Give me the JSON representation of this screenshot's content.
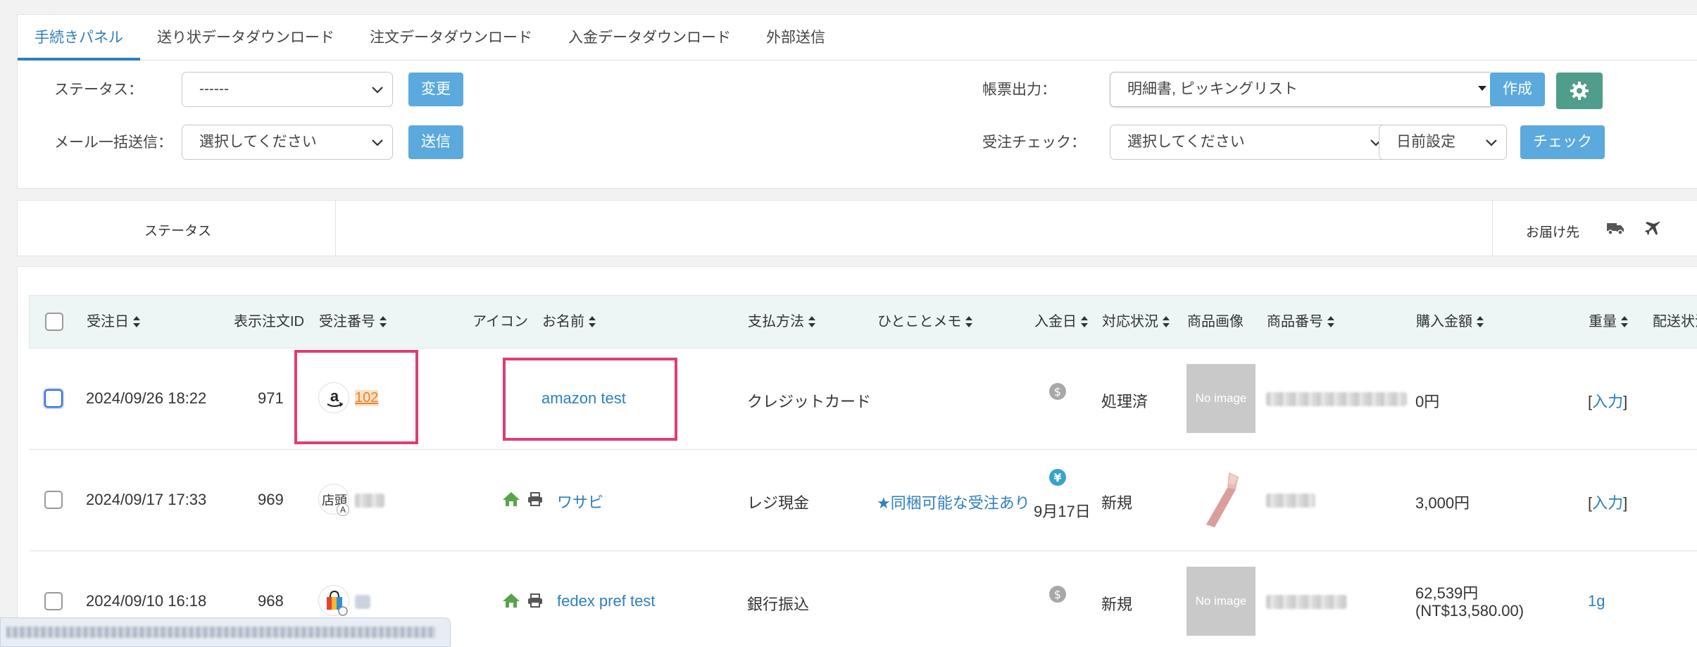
{
  "tabs": [
    {
      "label": "手続きパネル",
      "active": true
    },
    {
      "label": "送り状データダウンロード"
    },
    {
      "label": "注文データダウンロード"
    },
    {
      "label": "入金データダウンロード"
    },
    {
      "label": "外部送信"
    }
  ],
  "filters": {
    "status_label": "ステータス：",
    "status_value": "------",
    "change_button": "変更",
    "mail_label": "メール一括送信：",
    "mail_value": "選択してください",
    "send_button": "送信",
    "form_output_label": "帳票出力：",
    "form_output_value": "明細書, ピッキングリスト",
    "create_button": "作成",
    "order_check_label": "受注チェック：",
    "order_check_value": "選択してください",
    "date_setting_value": "日前設定",
    "check_button": "チェック"
  },
  "summary": {
    "status_label": "ステータス",
    "delivery_label": "お届け先"
  },
  "columns": {
    "order_date": "受注日",
    "display_id": "表示注文ID",
    "order_number": "受注番号",
    "icon": "アイコン",
    "name": "お名前",
    "payment": "支払方法",
    "memo": "ひとことメモ",
    "payment_date": "入金日",
    "handling_status": "対応状況",
    "product_image": "商品画像",
    "product_number": "商品番号",
    "purchase_amount": "購入金額",
    "weight": "重量",
    "shipping_status": "配送状況"
  },
  "rows": [
    {
      "date": "2024/09/26 18:22",
      "display_id": "971",
      "order_number": "102",
      "name": "amazon test",
      "payment": "クレジットカード",
      "memo": "",
      "payment_date": "",
      "status": "処理済",
      "image_text": "No image",
      "amount": "0円",
      "weight_prefix": "[",
      "weight_link": "入力",
      "weight_suffix": "]"
    },
    {
      "date": "2024/09/17 17:33",
      "display_id": "969",
      "shop_label": "店頭",
      "shop_sub": "A",
      "name": "ワサビ",
      "payment": "レジ現金",
      "memo": "★同梱可能な受注あり",
      "payment_date": "9月17日",
      "status": "新規",
      "amount": "3,000円",
      "weight_prefix": "[",
      "weight_link": "入力",
      "weight_suffix": "]"
    },
    {
      "date": "2024/09/10 16:18",
      "display_id": "968",
      "name": "fedex pref test",
      "payment": "銀行振込",
      "memo": "",
      "payment_date": "",
      "status": "新規",
      "image_text": "No image",
      "amount": "62,539円",
      "amount_sub": "(NT$13,580.00)",
      "weight_link": "1g"
    }
  ],
  "colors": {
    "accent": "#2e7fbf",
    "button": "#5ba9dd",
    "settings_button": "#4f9d8a",
    "highlight": "#e03c78",
    "order_number_link": "#e8842b"
  }
}
